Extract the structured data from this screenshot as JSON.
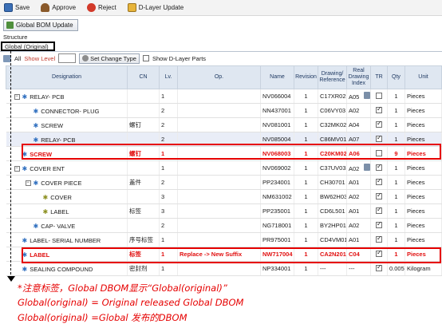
{
  "toolbar": {
    "buttons": [
      {
        "label": "Save",
        "icon": "save-icon"
      },
      {
        "label": "Approve",
        "icon": "approve-icon"
      },
      {
        "label": "Reject",
        "icon": "reject-icon"
      },
      {
        "label": "D-Layer Update",
        "icon": "dlayer-icon"
      }
    ]
  },
  "bom_update_label": "Global BOM Update",
  "structure_label": "Structure",
  "tab_label": "Global (Original)",
  "filter": {
    "all_label": "All",
    "show_level_label": "Show Level",
    "level_value": "",
    "set_change_type_label": "Set Change Type",
    "show_dlayer_label": "Show D-Layer Parts"
  },
  "columns": {
    "designation": "Designation",
    "cn": "CN",
    "lv": "Lv.",
    "op": "Op.",
    "name": "Name",
    "revision": "Revision",
    "drawing_ref": "Drawing/ Reference",
    "real_drawing_index": "Real Drawing Index",
    "tr": "TR",
    "qty": "Qty",
    "unit": "Unit"
  },
  "rows": [
    {
      "designation": "RELAY- PCB",
      "cn": "",
      "lv": "1",
      "op": "",
      "name": "NV066004",
      "revision": "1",
      "drawing": "C17XR02",
      "rdi": "A05",
      "tr": false,
      "doc": true,
      "qty": "1",
      "unit": "Pieces"
    },
    {
      "designation": "CONNECTOR- PLUG",
      "cn": "",
      "lv": "2",
      "op": "",
      "name": "NN437001",
      "revision": "1",
      "drawing": "C06VY03",
      "rdi": "A02",
      "tr": true,
      "doc": false,
      "qty": "1",
      "unit": "Pieces"
    },
    {
      "designation": "SCREW",
      "cn": "螺钉",
      "lv": "2",
      "op": "",
      "name": "NV081001",
      "revision": "1",
      "drawing": "C32MK02",
      "rdi": "A04",
      "tr": true,
      "doc": false,
      "qty": "1",
      "unit": "Pieces"
    },
    {
      "designation": "RELAY- PCB",
      "cn": "",
      "lv": "2",
      "op": "",
      "name": "NV085004",
      "revision": "1",
      "drawing": "C86MV01",
      "rdi": "A07",
      "tr": true,
      "doc": false,
      "qty": "1",
      "unit": "Pieces"
    },
    {
      "designation": "SCREW",
      "cn": "螺钉",
      "lv": "1",
      "op": "",
      "name": "NV068003",
      "revision": "1",
      "drawing": "C20KM02",
      "rdi": "A06",
      "tr": false,
      "doc": false,
      "qty": "9",
      "unit": "Pieces"
    },
    {
      "designation": "COVER ENT",
      "cn": "",
      "lv": "1",
      "op": "",
      "name": "NV069002",
      "revision": "1",
      "drawing": "C37UV03",
      "rdi": "A02",
      "tr": true,
      "doc": true,
      "qty": "1",
      "unit": "Pieces"
    },
    {
      "designation": "COVER PIECE",
      "cn": "盖件",
      "lv": "2",
      "op": "",
      "name": "PP234001",
      "revision": "1",
      "drawing": "CH30701",
      "rdi": "A01",
      "tr": true,
      "doc": false,
      "qty": "1",
      "unit": "Pieces"
    },
    {
      "designation": "COVER",
      "cn": "",
      "lv": "3",
      "op": "",
      "name": "NM631002",
      "revision": "1",
      "drawing": "BW62H03",
      "rdi": "A02",
      "tr": true,
      "doc": false,
      "qty": "1",
      "unit": "Pieces"
    },
    {
      "designation": "LABEL",
      "cn": "标签",
      "lv": "3",
      "op": "",
      "name": "PP235001",
      "revision": "1",
      "drawing": "CD6L501",
      "rdi": "A01",
      "tr": true,
      "doc": false,
      "qty": "1",
      "unit": "Pieces"
    },
    {
      "designation": "CAP- VALVE",
      "cn": "",
      "lv": "2",
      "op": "",
      "name": "NG718001",
      "revision": "1",
      "drawing": "BY2HP01",
      "rdi": "A02",
      "tr": true,
      "doc": false,
      "qty": "1",
      "unit": "Pieces"
    },
    {
      "designation": "LABEL- SERIAL NUMBER",
      "cn": "序号标签",
      "lv": "1",
      "op": "",
      "name": "PR975001",
      "revision": "1",
      "drawing": "CD4VM01",
      "rdi": "A01",
      "tr": true,
      "doc": false,
      "qty": "1",
      "unit": "Pieces"
    },
    {
      "designation": "LABEL",
      "cn": "标签",
      "lv": "1",
      "op": "Replace -> New Suffix",
      "name": "NW717004",
      "revision": "1",
      "drawing": "CA2N201",
      "rdi": "C04",
      "tr": true,
      "doc": false,
      "qty": "1",
      "unit": "Pieces"
    },
    {
      "designation": "SEALING COMPOUND",
      "cn": "密封剂",
      "lv": "1",
      "op": "",
      "name": "NP334001",
      "revision": "1",
      "drawing": "---",
      "rdi": "---",
      "tr": true,
      "doc": false,
      "qty": "0.005",
      "unit": "Kilogram"
    }
  ],
  "notes": {
    "line1": "*注意标签，Global DBOM显示“Global(original)”",
    "line2": "Global(original) = Original released Global DBOM",
    "line3": "Global(original) =Global 发布的DBOM"
  },
  "colors": {
    "annotation_red": "#e60000",
    "header_bg": "#dfe7f1",
    "highlight_row": "#e9edf7",
    "gear_blue": "#2f6fbf"
  }
}
